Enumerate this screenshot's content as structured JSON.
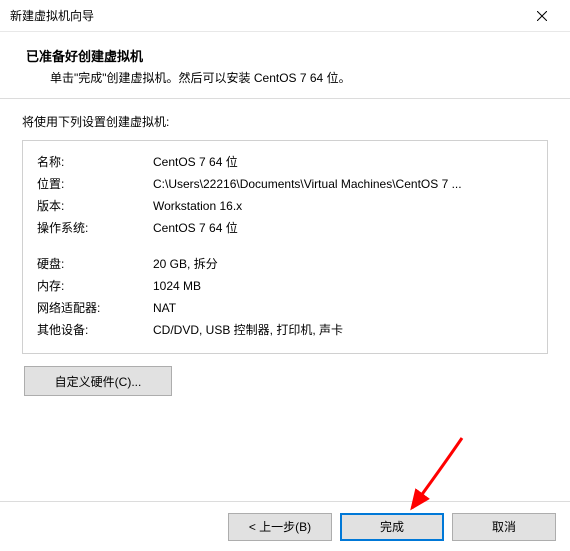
{
  "titlebar": {
    "title": "新建虚拟机向导"
  },
  "header": {
    "title": "已准备好创建虚拟机",
    "desc": "单击\"完成\"创建虚拟机。然后可以安装 CentOS 7 64 位。"
  },
  "content": {
    "title": "将使用下列设置创建虚拟机:"
  },
  "summary": {
    "rows1": [
      {
        "label": "名称:",
        "value": "CentOS 7 64 位"
      },
      {
        "label": "位置:",
        "value": "C:\\Users\\22216\\Documents\\Virtual Machines\\CentOS 7 ..."
      },
      {
        "label": "版本:",
        "value": "Workstation 16.x"
      },
      {
        "label": "操作系统:",
        "value": "CentOS 7 64 位"
      }
    ],
    "rows2": [
      {
        "label": "硬盘:",
        "value": "20 GB, 拆分"
      },
      {
        "label": "内存:",
        "value": "1024 MB"
      },
      {
        "label": "网络适配器:",
        "value": "NAT"
      },
      {
        "label": "其他设备:",
        "value": "CD/DVD, USB 控制器, 打印机, 声卡"
      }
    ]
  },
  "buttons": {
    "customize": "自定义硬件(C)...",
    "back": "< 上一步(B)",
    "finish": "完成",
    "cancel": "取消"
  }
}
